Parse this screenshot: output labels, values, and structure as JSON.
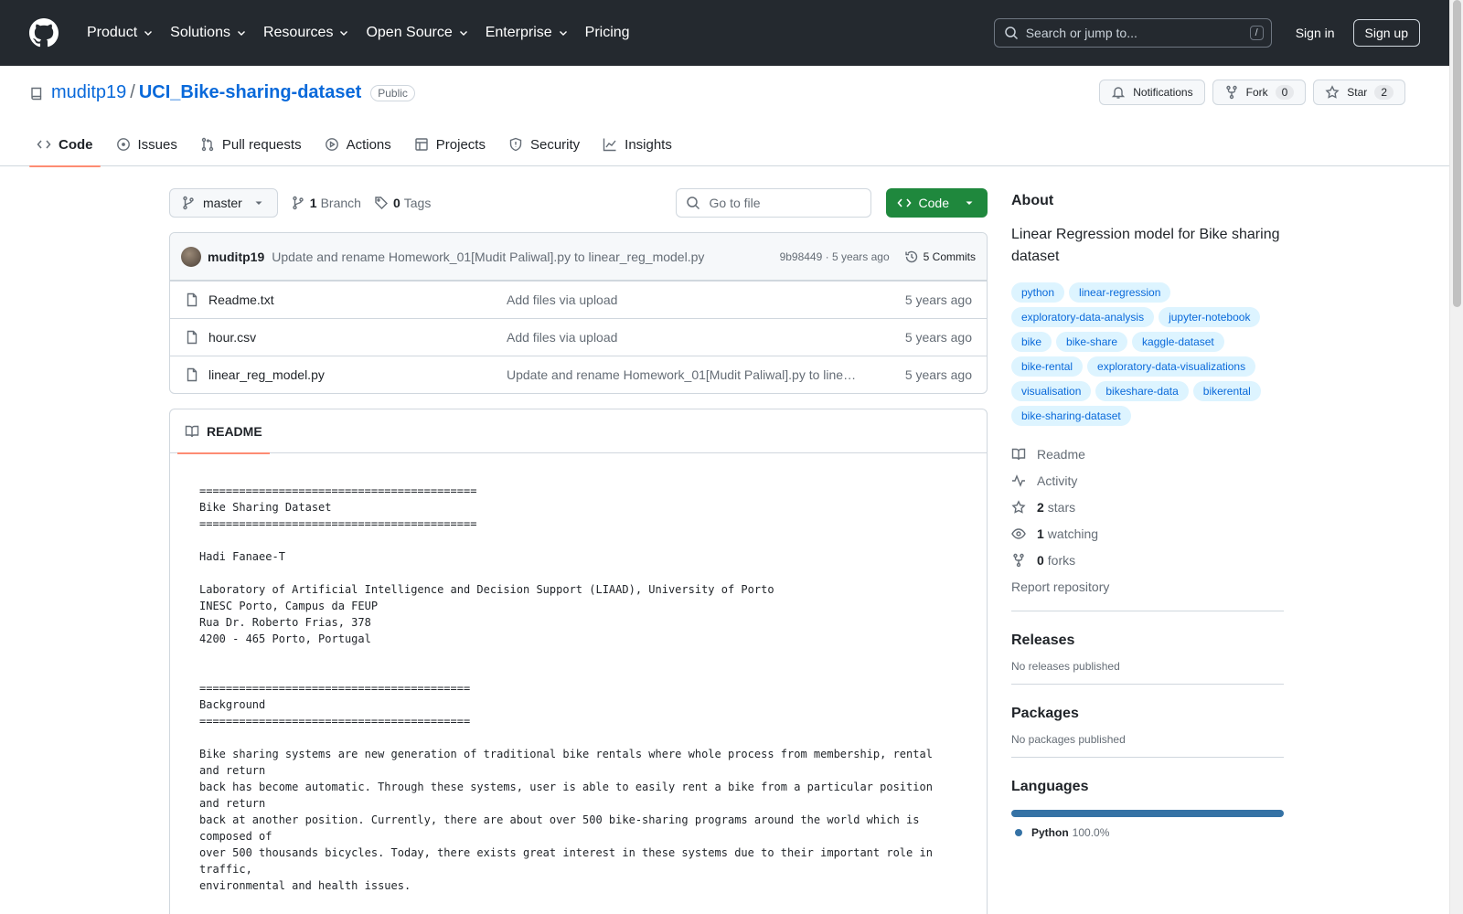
{
  "header": {
    "nav": [
      "Product",
      "Solutions",
      "Resources",
      "Open Source",
      "Enterprise",
      "Pricing"
    ],
    "search_placeholder": "Search or jump to...",
    "search_shortcut": "/",
    "sign_in": "Sign in",
    "sign_up": "Sign up"
  },
  "repo": {
    "owner": "muditp19",
    "separator": "/",
    "name": "UCI_Bike-sharing-dataset",
    "visibility": "Public",
    "notifications_label": "Notifications",
    "fork_label": "Fork",
    "fork_count": "0",
    "star_label": "Star",
    "star_count": "2",
    "tabs": [
      "Code",
      "Issues",
      "Pull requests",
      "Actions",
      "Projects",
      "Security",
      "Insights"
    ]
  },
  "toolbar": {
    "branch": "master",
    "branch_count": "1",
    "branch_label": "Branch",
    "tag_count": "0",
    "tag_label": "Tags",
    "goto_placeholder": "Go to file",
    "code_button": "Code"
  },
  "commit": {
    "author": "muditp19",
    "message": "Update and rename Homework_01[Mudit Paliwal].py to linear_reg_model.py",
    "hash_time": "9b98449 · 5 years ago",
    "commits_label": "5 Commits"
  },
  "files": [
    {
      "name": "Readme.txt",
      "message": "Add files via upload",
      "date": "5 years ago"
    },
    {
      "name": "hour.csv",
      "message": "Add files via upload",
      "date": "5 years ago"
    },
    {
      "name": "linear_reg_model.py",
      "message": "Update and rename Homework_01[Mudit Paliwal].py to linear_reg_model.py",
      "date": "5 years ago"
    }
  ],
  "readme": {
    "tab_label": "README",
    "content": "==========================================\nBike Sharing Dataset\n==========================================\n\nHadi Fanaee-T\n\nLaboratory of Artificial Intelligence and Decision Support (LIAAD), University of Porto\nINESC Porto, Campus da FEUP\nRua Dr. Roberto Frias, 378\n4200 - 465 Porto, Portugal\n\n\n=========================================\nBackground\n=========================================\n\nBike sharing systems are new generation of traditional bike rentals where whole process from membership, rental and return\nback has become automatic. Through these systems, user is able to easily rent a bike from a particular position and return\nback at another position. Currently, there are about over 500 bike-sharing programs around the world which is composed of\nover 500 thousands bicycles. Today, there exists great interest in these systems due to their important role in traffic,\nenvironmental and health issues."
  },
  "about": {
    "title": "About",
    "description": "Linear Regression model for Bike sharing dataset",
    "topics": [
      "python",
      "linear-regression",
      "exploratory-data-analysis",
      "jupyter-notebook",
      "bike",
      "bike-share",
      "kaggle-dataset",
      "bike-rental",
      "exploratory-data-visualizations",
      "visualisation",
      "bikeshare-data",
      "bikerental",
      "bike-sharing-dataset"
    ],
    "readme_link": "Readme",
    "activity_link": "Activity",
    "stars_count": "2",
    "stars_label": "stars",
    "watching_count": "1",
    "watching_label": "watching",
    "forks_count": "0",
    "forks_label": "forks",
    "report": "Report repository"
  },
  "releases": {
    "title": "Releases",
    "text": "No releases published"
  },
  "packages": {
    "title": "Packages",
    "text": "No packages published"
  },
  "languages": {
    "title": "Languages",
    "items": [
      {
        "name": "Python",
        "percent": "100.0%",
        "color": "#3572A5"
      }
    ]
  },
  "colors": {
    "header_bg": "#24292f",
    "link": "#0969da",
    "code_button": "#1f883d",
    "active_tab": "#fd8c73"
  }
}
